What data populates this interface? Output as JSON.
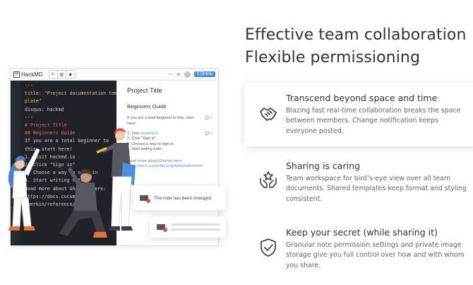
{
  "headline": {
    "line1": "Effective team collaboration",
    "line2": "Flexible permissioning"
  },
  "features": [
    {
      "title": "Transcend beyond space and time",
      "description": "Blazing fast real-time collaboration breaks the space between members. Change notification keeps everyone posted.",
      "icon": "handshake-icon"
    },
    {
      "title": "Sharing is caring",
      "description": "Team workspace for bird’s-eye view over all team documents. Shared templates keep format and styling consistent.",
      "icon": "hands-star-icon"
    },
    {
      "title": "Keep your secret (while sharing it)",
      "description": "Granular note permission settings and private image storage give you full control over how and with whom you share.",
      "icon": "shield-check-icon"
    }
  ],
  "app": {
    "brand": "HackMD",
    "online_badge": "3 Online",
    "editor_lines": [
      "---",
      "title: \"Project documentation tem-",
      "plate\"",
      "disqus: hackmd",
      "---",
      "",
      "# Project Title",
      "",
      "## Beginners Guide",
      "",
      "If you are a total beginner to",
      "this, start here!",
      "",
      "1. Visit hackmd.io",
      "2. Click \"Sign in\"",
      "3. Choose a way to sign in",
      "4. Start writing note!",
      "",
      "Read more about Gherkin here:",
      "https://docs.cucumber.io/",
      "gherkin/reference/"
    ],
    "preview": {
      "title": "Project Title",
      "subtitle": "Beginners Guide",
      "intro": "If you are a total beginner to this, start here!",
      "comment_count_1": "1",
      "comment_count_2": "1",
      "steps": [
        "1. Visit hackmd.io",
        "2. Click \"Sign in\"",
        "3. Choose a way to sign in",
        "4. Start writing note!"
      ],
      "more_label": "Read more about Gherkin here:",
      "more_link": "https://docs.cucumber.io/gherkin/reference/"
    },
    "notification": "The note has been changed"
  },
  "colors": {
    "accent": "#4a90e2",
    "editor_bg": "#1f2227",
    "notify_dot": "#e84a4a"
  }
}
